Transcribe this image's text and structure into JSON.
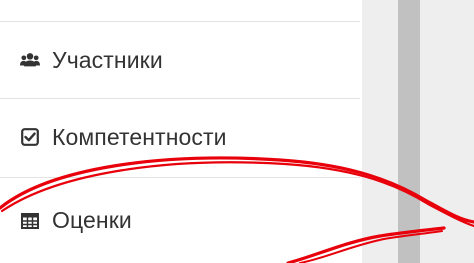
{
  "sidebar": {
    "items": [
      {
        "label": "Участники",
        "icon": "users-icon"
      },
      {
        "label": "Компетентности",
        "icon": "check-square-icon"
      },
      {
        "label": "Оценки",
        "icon": "table-icon"
      }
    ]
  },
  "colors": {
    "text": "#333333",
    "divider": "#e3e3e3",
    "scrollbar": "#c1c1c1",
    "panel": "#eeeeee",
    "annotation": "#e8000b"
  }
}
